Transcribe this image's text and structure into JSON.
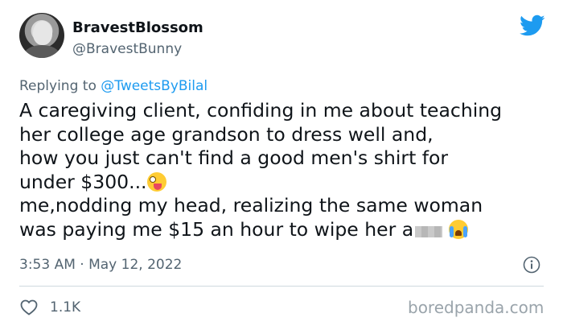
{
  "user": {
    "display_name": "BravestBlossom",
    "handle": "@BravestBunny"
  },
  "reply": {
    "prefix": "Replying to ",
    "mention": "@TweetsByBilal"
  },
  "tweet": {
    "lines": [
      "A caregiving client, confiding in me about teaching",
      "her college age grandson to dress well and,",
      "how you just can't find a good men's shirt for",
      "under $300...",
      "me,nodding my head, realizing the same woman",
      "was paying me $15 an hour to wipe her a"
    ],
    "emojis": [
      "zany-face-emoji",
      "loudly-crying-face-emoji"
    ]
  },
  "meta": {
    "timestamp": "3:53 AM · May 12, 2022"
  },
  "engagement": {
    "likes": "1.1K"
  },
  "watermark": "boredpanda.com",
  "colors": {
    "twitter_blue": "#1d9bf0",
    "secondary_text": "#536471",
    "primary_text": "#0f1419",
    "divider": "#cfd9de"
  },
  "icons": [
    "twitter-bird-icon",
    "info-icon",
    "heart-icon"
  ]
}
